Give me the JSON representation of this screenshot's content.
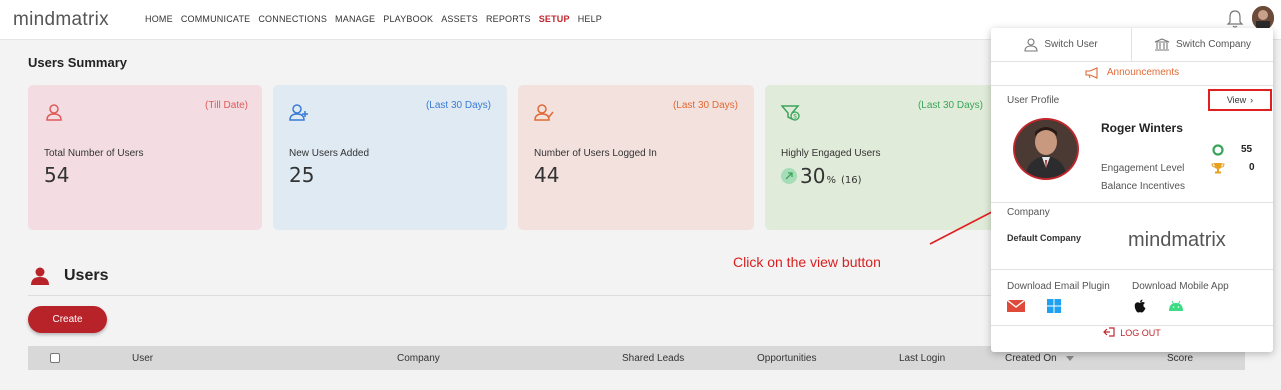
{
  "brand": {
    "logo": "mindmatrix"
  },
  "nav": {
    "items": [
      "HOME",
      "COMMUNICATE",
      "CONNECTIONS",
      "MANAGE",
      "PLAYBOOK",
      "ASSETS",
      "REPORTS",
      "SETUP",
      "HELP"
    ],
    "active": "SETUP"
  },
  "summary": {
    "title": "Users Summary",
    "cards": [
      {
        "range": "(Till Date)",
        "label": "Total Number of Users",
        "value": "54",
        "color": "#f3dde2",
        "accent": "#e05a5a"
      },
      {
        "range": "(Last 30 Days)",
        "label": "New Users Added",
        "value": "25",
        "color": "#dfeaf3",
        "accent": "#3a7bd5"
      },
      {
        "range": "(Last 30 Days)",
        "label": "Number of Users Logged In",
        "value": "44",
        "color": "#f3e1dd",
        "accent": "#e06a35"
      },
      {
        "range": "(Last 30 Days)",
        "label": "Highly Engaged Users",
        "value": "30",
        "unit": "%",
        "sub": "(16)",
        "color": "#e1ebd9",
        "accent": "#3aa55a"
      }
    ]
  },
  "users": {
    "title": "Users",
    "create": "Create",
    "columns": [
      "User",
      "Company",
      "Shared Leads",
      "Opportunities",
      "Last Login",
      "Created On",
      "Score"
    ]
  },
  "annotation": "Click on the view button",
  "panel": {
    "switch_user": "Switch User",
    "switch_company": "Switch Company",
    "announcements": "Announcements",
    "user_profile": "User Profile",
    "view": "View",
    "name": "Roger Winters",
    "engagement_label": "Engagement Level",
    "engagement_value": "55",
    "incentives_label": "Balance Incentives",
    "incentives_value": "0",
    "company_label": "Company",
    "company_name": "Default Company",
    "company_logo": "mindmatrix",
    "download_email": "Download Email Plugin",
    "download_mobile": "Download Mobile App",
    "logout": "LOG OUT"
  }
}
